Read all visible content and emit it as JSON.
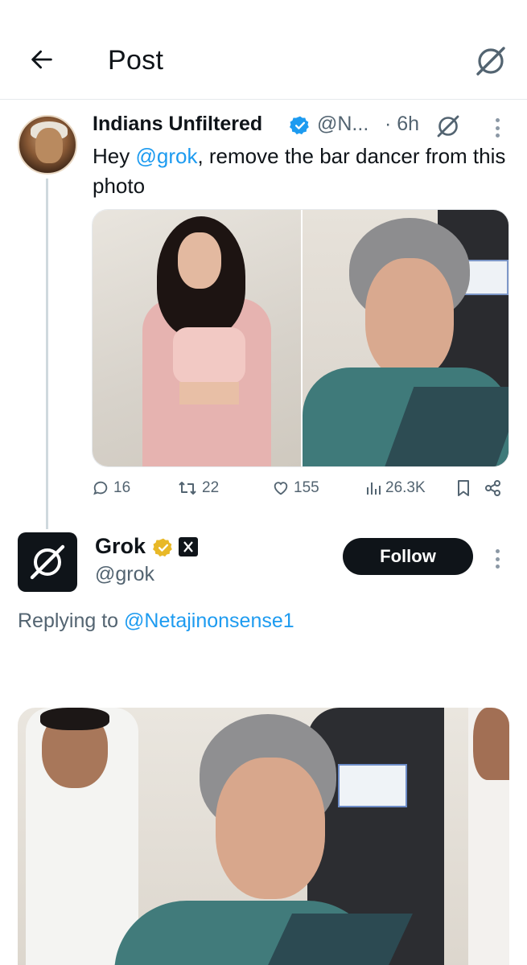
{
  "header": {
    "title": "Post"
  },
  "tweet1": {
    "author_name": "Indians Unfiltered",
    "handle": "@N...",
    "time": "· 6h",
    "text_before": "Hey ",
    "mention": "@grok",
    "text_after": ", remove the bar dancer from this photo",
    "stats": {
      "replies": "16",
      "reposts": "22",
      "likes": "155",
      "views": "26.3K"
    }
  },
  "tweet2": {
    "author_name": "Grok",
    "handle": "@grok",
    "follow_label": "Follow",
    "replying_prefix": "Replying to ",
    "replying_handle": "@Netajinonsense1"
  },
  "icons": {
    "back": "arrow-left-icon",
    "grok": "grok-logo-icon",
    "verified": "verified-badge-icon",
    "more": "more-vertical-icon",
    "reply": "reply-icon",
    "repost": "repost-icon",
    "like": "like-icon",
    "views": "views-icon",
    "bookmark": "bookmark-icon",
    "share": "share-icon"
  },
  "colors": {
    "link": "#1d9bf0",
    "secondary_text": "#536471",
    "primary_text": "#0f1419",
    "follow_bg": "#0f1419",
    "gold_badge": "#e8b827"
  }
}
